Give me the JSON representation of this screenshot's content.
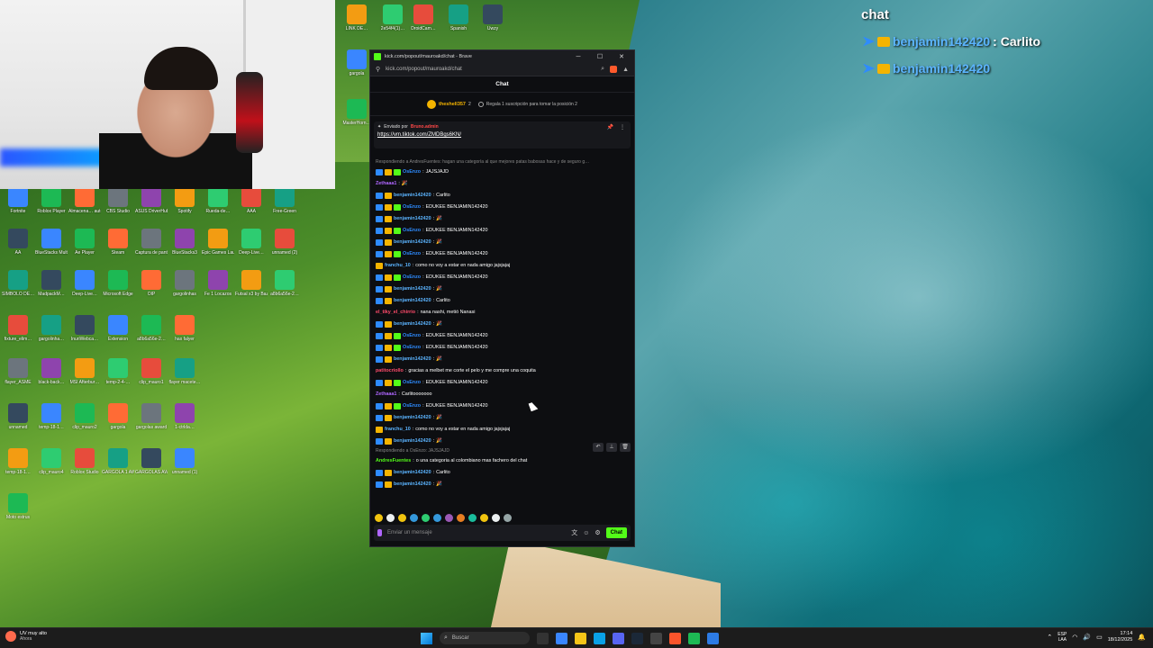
{
  "overlay": {
    "chat_label": "chat",
    "lines": [
      {
        "user": "benjamin142420",
        "message": "Carlito"
      },
      {
        "user": "benjamin142420",
        "message": ""
      }
    ]
  },
  "desktop_icons": [
    "Fortnite",
    "Roblox Player",
    "Almacena… automatic…",
    "CBS Studio",
    "ASUS DriverHub",
    "Spotify",
    "Rueda-de…",
    "AAA",
    "Free-Green",
    "AA",
    "BlueStacks Multi-Insta…",
    "Ae Player",
    "Steam",
    "Captura de pantalla…",
    "BlueStacks3",
    "Epic Games Launcher",
    "Deep-Live…",
    "unnamed (2)",
    "SIMBOLO DE…",
    "MadpackM…",
    "Deep-Live…",
    "Microsoft Edge",
    "OIP",
    "gargolinhas",
    "Fe 1 Locazos",
    "Futsal x3 by Bazinga fro…",
    "a8b6a56e-2…",
    "fixture_elim…",
    "gargolinha…",
    "InuriWebca…",
    "Extension",
    "a8b6a56e-2…",
    "hax falyer",
    "flayer_ASME",
    "black-back…",
    "MSI Afterbur…",
    "temp-2-4-…",
    "clip_mauro1",
    "flayer macete…",
    "unnamed",
    "temp-18-1…",
    "clip_mauro2",
    "gargola",
    "gargolas award",
    "1-ctrlda…",
    "temp-18-1…",
    "clip_mauro4",
    "Roblox Studio",
    "GARGOLA 1 AWARDS",
    "GARGOLAS AWARDSD",
    "unnamed (1)",
    "Moto estrus",
    "LINK DE…",
    "2e54f4(1)…",
    "DroidCam…",
    "Spanish",
    "Uwzy",
    "gargola",
    "MasterHorn…"
  ],
  "browser": {
    "title": "kick.com/popout/mauroakd/chat - Brave",
    "url": "kick.com/popout/mauroakd/chat",
    "accent": "#53fc18",
    "header": "Chat",
    "gift_leader": {
      "name": "theshell357",
      "count": "2"
    },
    "gift_text": "Regala 1 suscripción para tomar la posición 2",
    "pinned": {
      "label": "Enviado por",
      "from": "Bruno.admin",
      "link": "https://vm.tiktok.com/ZMDBgs6KN/"
    },
    "messages": [
      {
        "type": "reply",
        "text": "Respondiendo a AndresFuentes: hagan una categoría al que mejores patas babosas hace y de seguro g…"
      },
      {
        "user": "OsEnzo",
        "color": "#2e8bff",
        "text": "JAJSJAJD",
        "badges": [
          "b1",
          "b2",
          "b3"
        ]
      },
      {
        "user": "Zethaaa1",
        "color": "#b066ff",
        "text": "🎉",
        "badges": []
      },
      {
        "user": "benjamin142420",
        "color": "#5bb4ff",
        "text": "Carlito",
        "badges": [
          "b1",
          "b2"
        ]
      },
      {
        "user": "OsEnzo",
        "color": "#2e8bff",
        "text": "EDUKEE BENJAMIN142420",
        "badges": [
          "b1",
          "b2",
          "b3"
        ]
      },
      {
        "user": "benjamin142420",
        "color": "#5bb4ff",
        "text": "🎉",
        "badges": [
          "b1",
          "b2"
        ]
      },
      {
        "user": "OsEnzo",
        "color": "#2e8bff",
        "text": "EDUKEE BENJAMIN142420",
        "badges": [
          "b1",
          "b2",
          "b3"
        ]
      },
      {
        "user": "benjamin142420",
        "color": "#5bb4ff",
        "text": "🎉",
        "badges": [
          "b1",
          "b2"
        ]
      },
      {
        "user": "OsEnzo",
        "color": "#2e8bff",
        "text": "EDUKEE BENJAMIN142420",
        "badges": [
          "b1",
          "b2",
          "b3"
        ]
      },
      {
        "user": "franchu_10",
        "color": "#5bb4ff",
        "text": "como no voy a estar en nada amigo jajsjajaj",
        "badges": [
          "b2"
        ]
      },
      {
        "user": "OsEnzo",
        "color": "#2e8bff",
        "text": "EDUKEE BENJAMIN142420",
        "badges": [
          "b1",
          "b2",
          "b3"
        ]
      },
      {
        "user": "benjamin142420",
        "color": "#5bb4ff",
        "text": "🎉",
        "badges": [
          "b1",
          "b2"
        ]
      },
      {
        "user": "benjamin142420",
        "color": "#5bb4ff",
        "text": "Carlito",
        "badges": [
          "b1",
          "b2"
        ]
      },
      {
        "user": "el_tiky_el_chirrio",
        "color": "#ff4b6b",
        "text": "nana nashi, metió Nanasi",
        "badges": []
      },
      {
        "user": "benjamin142420",
        "color": "#5bb4ff",
        "text": "🎉",
        "badges": [
          "b1",
          "b2"
        ]
      },
      {
        "user": "OsEnzo",
        "color": "#2e8bff",
        "text": "EDUKEE BENJAMIN142420",
        "badges": [
          "b1",
          "b2",
          "b3"
        ]
      },
      {
        "user": "OsEnzo",
        "color": "#2e8bff",
        "text": "EDUKEE BENJAMIN142420",
        "badges": [
          "b1",
          "b2",
          "b3"
        ]
      },
      {
        "user": "benjamin142420",
        "color": "#5bb4ff",
        "text": "🎉",
        "badges": [
          "b1",
          "b2"
        ]
      },
      {
        "user": "patitocriollo",
        "color": "#ff4b6b",
        "text": "gracias a melbet me corte el pelo y me compre una coquita",
        "badges": []
      },
      {
        "user": "OsEnzo",
        "color": "#2e8bff",
        "text": "EDUKEE BENJAMIN142420",
        "badges": [
          "b1",
          "b2",
          "b3"
        ]
      },
      {
        "user": "Zethaaa1",
        "color": "#b066ff",
        "text": "Carlitooooooo",
        "badges": []
      },
      {
        "user": "OsEnzo",
        "color": "#2e8bff",
        "text": "EDUKEE BENJAMIN142420",
        "badges": [
          "b1",
          "b2",
          "b3"
        ]
      },
      {
        "user": "benjamin142420",
        "color": "#5bb4ff",
        "text": "🎉",
        "badges": [
          "b1",
          "b2"
        ]
      },
      {
        "user": "franchu_10",
        "color": "#5bb4ff",
        "text": "como no voy a estar en nada amigo jajsjajaj",
        "badges": [
          "b2"
        ]
      },
      {
        "user": "benjamin142420",
        "color": "#5bb4ff",
        "text": "🎉",
        "badges": [
          "b1",
          "b2"
        ]
      },
      {
        "type": "reply",
        "text": "Respondiendo a OsEnzo: JAJSJAJD"
      },
      {
        "user": "AndresFuentes",
        "color": "#53fc18",
        "text": "o una categoria al colombiano mas fachero del chat",
        "badges": []
      },
      {
        "user": "benjamin142420",
        "color": "#5bb4ff",
        "text": "Carlito",
        "badges": [
          "b1",
          "b2"
        ]
      },
      {
        "user": "benjamin142420",
        "color": "#5bb4ff",
        "text": "🎉",
        "badges": [
          "b1",
          "b2"
        ]
      }
    ],
    "input_placeholder": "Enviar un mensaje",
    "send_label": "Chat"
  },
  "taskbar": {
    "weather_temp": "UV muy alto",
    "weather_sub": "Ahora",
    "search_placeholder": "Buscar",
    "lang_1": "ESP",
    "lang_2": "LAA",
    "time": "17:14",
    "date": "18/12/2025"
  }
}
